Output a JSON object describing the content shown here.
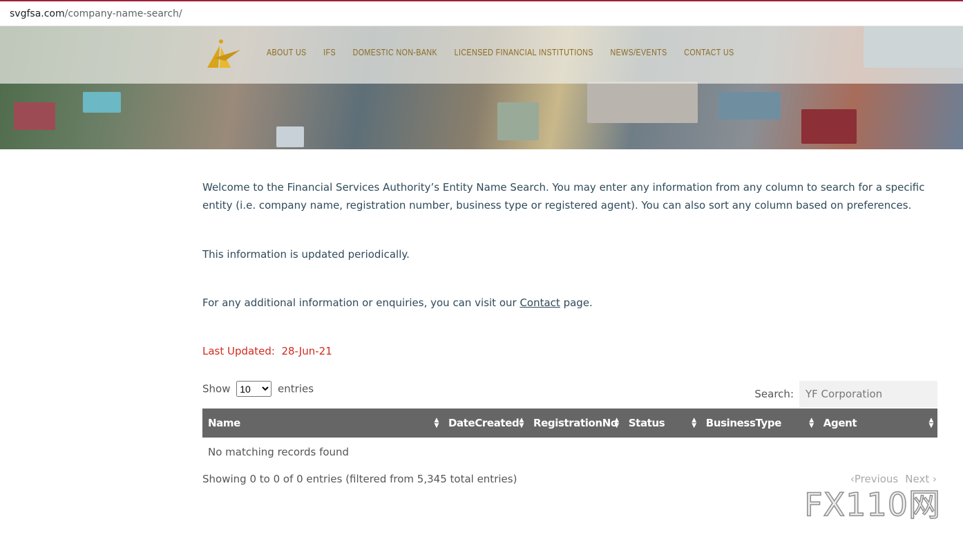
{
  "browser": {
    "url_host": "svgfsa.com",
    "url_path": "/company-name-search/"
  },
  "nav": {
    "items": [
      "ABOUT US",
      "IFS",
      "DOMESTIC NON-BANK",
      "LICENSED FINANCIAL INSTITUTIONS",
      "NEWS/EVENTS",
      "CONTACT US"
    ]
  },
  "content": {
    "intro": "Welcome to the Financial Services Authority’s Entity Name Search. You may enter any information from any column to search for a specific entity (i.e. company name, registration number, business type or registered agent). You can also sort any column based on preferences.",
    "updated_note": "This information is updated periodically.",
    "enquiry_prefix": "For any additional information or enquiries, you can visit our ",
    "enquiry_link": "Contact",
    "enquiry_suffix": " page.",
    "last_updated_label": "Last Updated:",
    "last_updated_value": "28-Jun-21"
  },
  "table_controls": {
    "show_label": "Show",
    "entries_label": "entries",
    "page_size": "10",
    "search_label": "Search:",
    "search_value": "YF Corporation"
  },
  "table": {
    "columns": [
      "Name",
      "DateCreated",
      "RegistrationNo",
      "Status",
      "BusinessType",
      "Agent"
    ],
    "empty_message": "No matching records found"
  },
  "footer": {
    "info": "Showing 0 to 0 of 0 entries (filtered from 5,345 total entries)",
    "previous": "Previous",
    "next": "Next"
  },
  "watermark": "FX110网",
  "colors": {
    "nav_text": "#8a6a1e",
    "header_bg": "#666666",
    "last_updated": "#d12a1f"
  }
}
